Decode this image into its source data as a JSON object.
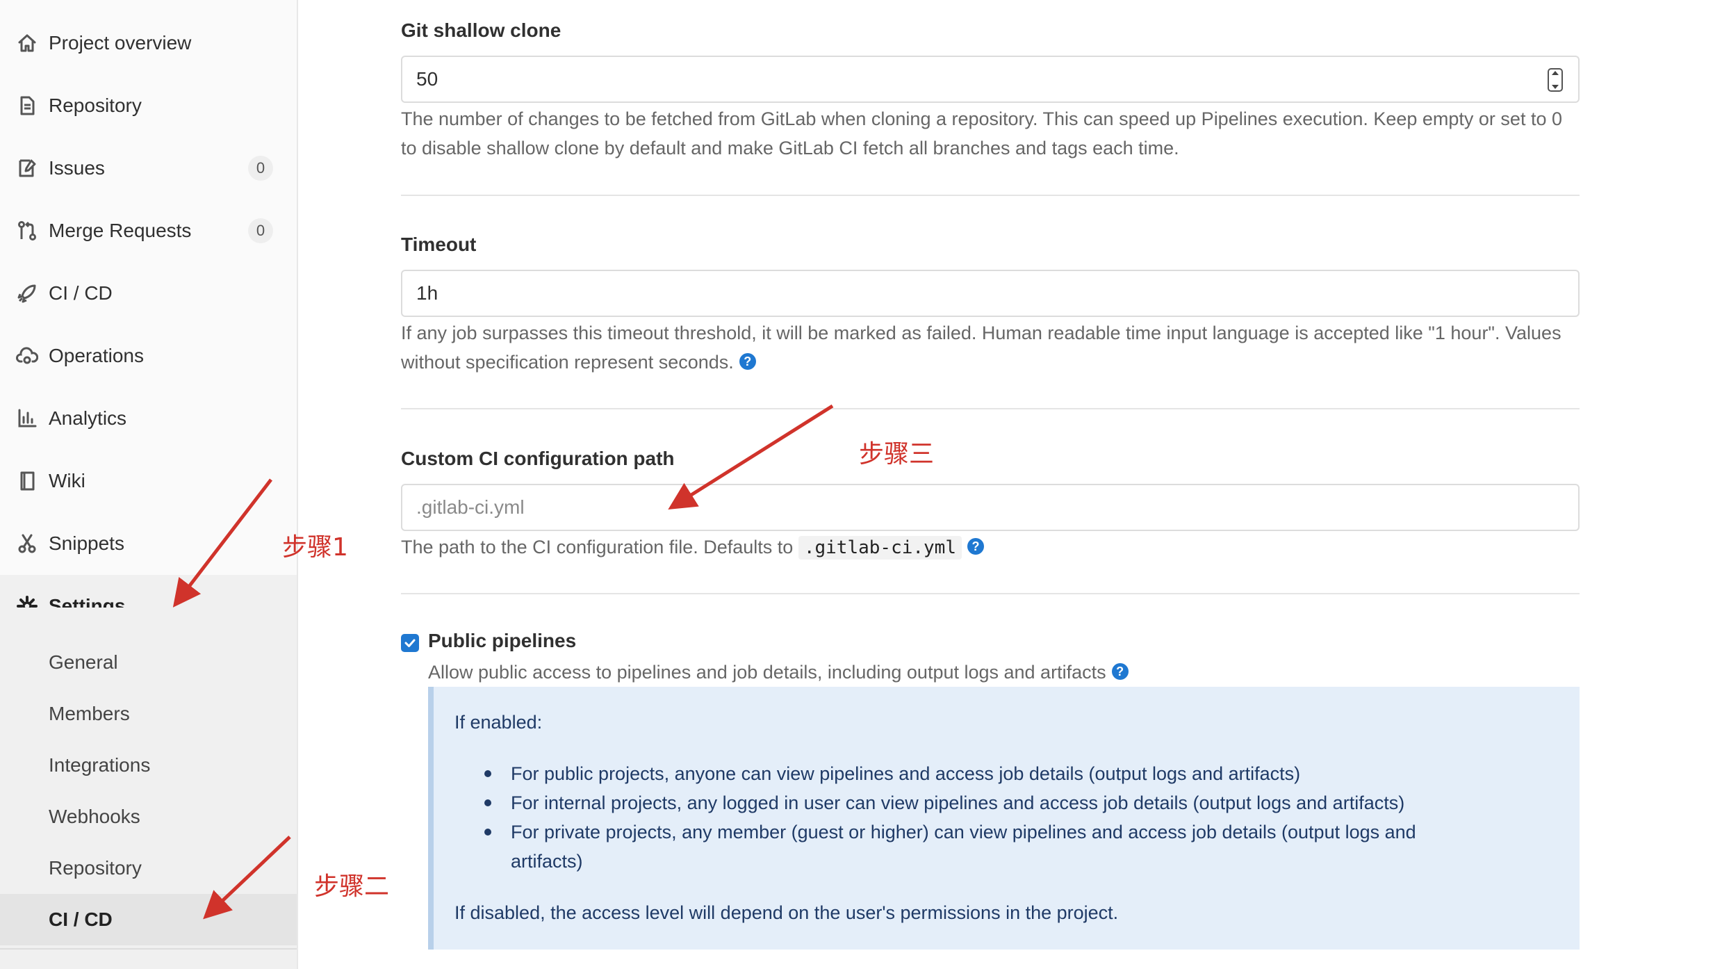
{
  "sidebar": {
    "items": [
      {
        "label": "Project overview",
        "icon": "home-icon"
      },
      {
        "label": "Repository",
        "icon": "document-icon"
      },
      {
        "label": "Issues",
        "icon": "issues-icon",
        "badge": "0"
      },
      {
        "label": "Merge Requests",
        "icon": "merge-request-icon",
        "badge": "0"
      },
      {
        "label": "CI / CD",
        "icon": "rocket-icon"
      },
      {
        "label": "Operations",
        "icon": "cloud-gear-icon"
      },
      {
        "label": "Analytics",
        "icon": "bar-chart-icon"
      },
      {
        "label": "Wiki",
        "icon": "book-icon"
      },
      {
        "label": "Snippets",
        "icon": "scissors-icon"
      },
      {
        "label": "Settings",
        "icon": "gear-icon"
      }
    ],
    "settings_sub": [
      "General",
      "Members",
      "Integrations",
      "Webhooks",
      "Repository",
      "CI / CD"
    ]
  },
  "main": {
    "shallow": {
      "label": "Git shallow clone",
      "value": "50",
      "help": "The number of changes to be fetched from GitLab when cloning a repository. This can speed up Pipelines execution. Keep empty or set to 0 to disable shallow clone by default and make GitLab CI fetch all branches and tags each time."
    },
    "timeout": {
      "label": "Timeout",
      "value": "1h",
      "help": "If any job surpasses this timeout threshold, it will be marked as failed. Human readable time input language is accepted like \"1 hour\". Values without specification represent seconds."
    },
    "ci_path": {
      "label": "Custom CI configuration path",
      "placeholder": ".gitlab-ci.yml",
      "help_prefix": "The path to the CI configuration file. Defaults to",
      "help_code": ".gitlab-ci.yml"
    },
    "public_pipelines": {
      "label": "Public pipelines",
      "checked": true,
      "help": "Allow public access to pipelines and job details, including output logs and artifacts",
      "info_title": "If enabled:",
      "info_items": [
        "For public projects, anyone can view pipelines and access job details (output logs and artifacts)",
        "For internal projects, any logged in user can view pipelines and access job details (output logs and artifacts)",
        "For private projects, any member (guest or higher) can view pipelines and access job details (output logs and artifacts)"
      ],
      "info_disabled": "If disabled, the access level will depend on the user's permissions in the project."
    },
    "help_icon": "?"
  },
  "annotations": {
    "step1": "步骤1",
    "step2": "步骤二",
    "step3": "步骤三",
    "color": "#d0332b"
  },
  "colors": {
    "accent": "#1f78d1",
    "info_bg": "#e4eef9",
    "info_text": "#1f3a66"
  }
}
